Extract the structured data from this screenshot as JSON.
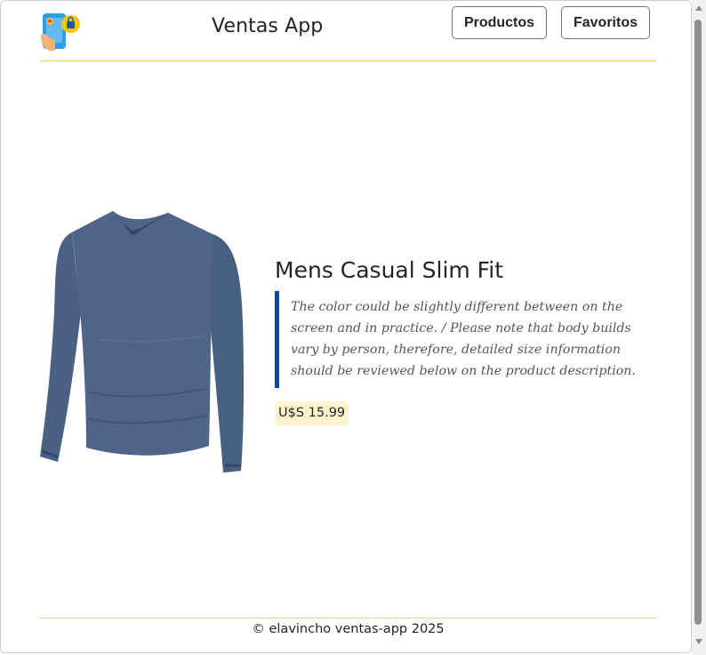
{
  "header": {
    "logo_icon": "shopping-phone-icon",
    "brand": "Ventas App",
    "nav": [
      {
        "label": "Productos"
      },
      {
        "label": "Favoritos"
      }
    ]
  },
  "product": {
    "image_icon": "long-sleeve-shirt-image",
    "title": "Mens Casual Slim Fit",
    "description": "The color could be slightly different between on the screen and in practice. / Please note that body builds vary by person, therefore, detailed size information should be reviewed below on the product description.",
    "price": "U$S 15.99"
  },
  "footer": {
    "text": "© elavincho ventas-app 2025"
  },
  "colors": {
    "accent_rule": "#e8d44d",
    "quote_border": "#0d47a1",
    "price_bg": "#fff3cd",
    "shirt": "#4b6284"
  }
}
